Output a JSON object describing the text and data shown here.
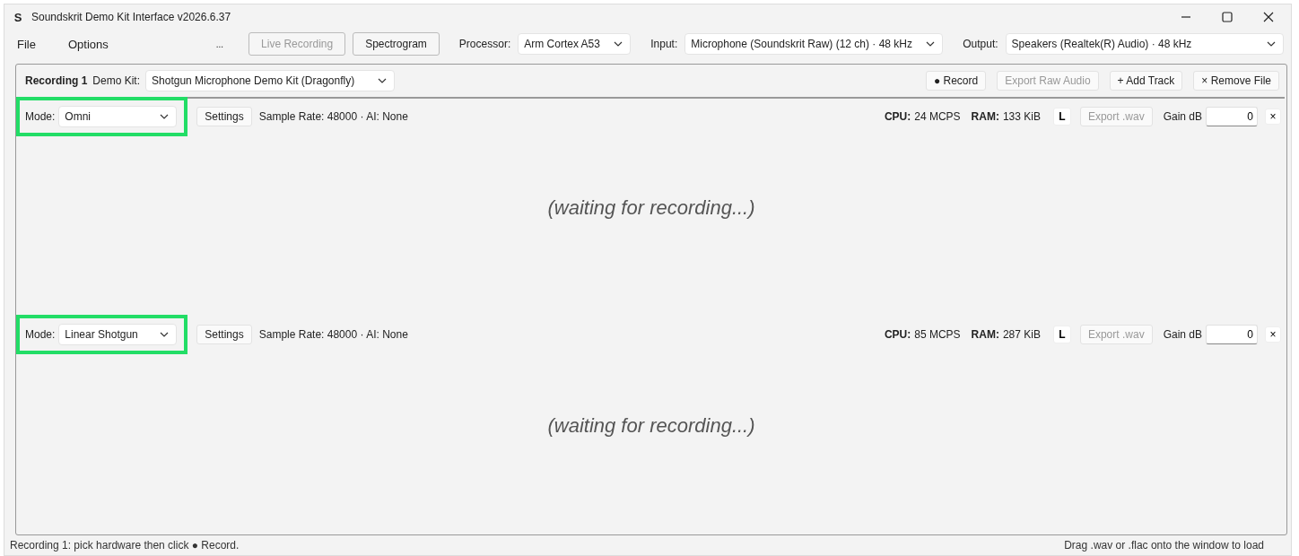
{
  "window": {
    "title": "Soundskrit Demo Kit Interface v2026.6.37",
    "logo": "S"
  },
  "menu": [
    {
      "label": "File"
    },
    {
      "label": "Options"
    }
  ],
  "toolbar": {
    "more": "...",
    "buttons": [
      {
        "label": "Live Recording",
        "disabled": true
      },
      {
        "label": "Spectrogram",
        "disabled": false
      }
    ],
    "selects": [
      {
        "label": "Processor:",
        "value": "Arm Cortex A53"
      },
      {
        "label": "Input:",
        "value": "Microphone (Soundskrit Raw)  (12 ch) · 48 kHz"
      },
      {
        "label": "Output:",
        "value": "Speakers (Realtek(R) Audio) · 48 kHz"
      }
    ]
  },
  "recording": {
    "title": "Recording 1",
    "kit_label": "Demo Kit:",
    "kit_value": "Shotgun Microphone Demo Kit (Dragonfly)",
    "buttons": [
      {
        "label": "● Record",
        "disabled": false
      },
      {
        "label": "Export Raw Audio",
        "disabled": true
      },
      {
        "label": "+ Add Track",
        "disabled": false
      },
      {
        "label": "× Remove File",
        "disabled": false
      }
    ],
    "tracks": [
      {
        "mode_label": "Mode:",
        "mode": "Omni",
        "highlighted": true,
        "settings": "Settings",
        "info": "Sample Rate: 48000 · AI: None",
        "cpu_label": "CPU:",
        "cpu": "24 MCPS",
        "ram_label": "RAM:",
        "ram": "133 KiB",
        "channel": "L",
        "export": {
          "label": "Export .wav",
          "disabled": true
        },
        "gain_label": "Gain dB",
        "gain": "0",
        "close": "×",
        "placeholder": "(waiting for recording...)"
      },
      {
        "mode_label": "Mode:",
        "mode": "Linear Shotgun",
        "highlighted": true,
        "settings": "Settings",
        "info": "Sample Rate: 48000 · AI: None",
        "cpu_label": "CPU:",
        "cpu": "85 MCPS",
        "ram_label": "RAM:",
        "ram": "287 KiB",
        "channel": "L",
        "export": {
          "label": "Export .wav",
          "disabled": true
        },
        "gain_label": "Gain dB",
        "gain": "0",
        "close": "×",
        "placeholder": "(waiting for recording...)"
      }
    ]
  },
  "status_bar": {
    "left": "Recording 1: pick hardware then click ● Record.",
    "right": "Drag .wav or .flac onto the window to load"
  }
}
